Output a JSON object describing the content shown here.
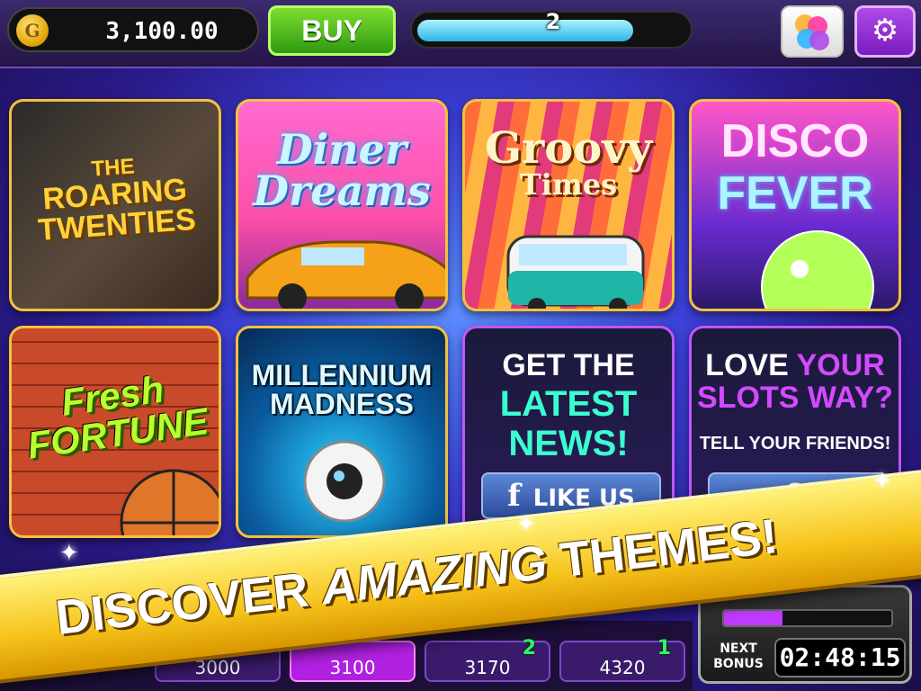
{
  "top_bar": {
    "balance": "3,100.00",
    "coin_symbol": "G",
    "buy_label": "BUY",
    "level": "2",
    "level_progress_pct": 80,
    "icons": {
      "game_center": "game-center-icon",
      "settings": "gear-icon"
    }
  },
  "themes": [
    {
      "title_lines": [
        "THE",
        "ROARING",
        "TWENTIES"
      ]
    },
    {
      "title_lines": [
        "Diner",
        "Dreams"
      ]
    },
    {
      "title_lines": [
        "Groovy",
        "Times"
      ]
    },
    {
      "title_lines": [
        "DISCO",
        "FEVER"
      ]
    },
    {
      "title_lines": [
        "Fresh",
        "FORTUNE"
      ]
    },
    {
      "title_lines": [
        "MILLENNIUM",
        "MADNESS"
      ]
    }
  ],
  "news_card": {
    "line1": "GET THE",
    "line2": "LATEST",
    "line3": "NEWS!",
    "button_label": "LIKE US",
    "fb_glyph": "f"
  },
  "share_card": {
    "line1_a": "LOVE",
    "line1_b": "YOUR",
    "line2": "SLOTS WAY?",
    "line3": "TELL YOUR FRIENDS!",
    "fb_glyph": "f"
  },
  "banner": {
    "word1": "DISCOVER",
    "word2": "AMAZING",
    "word3": "THEMES!"
  },
  "leaderboard": [
    {
      "score": "3000",
      "rank": ""
    },
    {
      "score": "3100",
      "rank": ""
    },
    {
      "score": "3170",
      "rank": "2"
    },
    {
      "score": "4320",
      "rank": "1"
    }
  ],
  "bonus": {
    "label_line1": "NEXT",
    "label_line2": "BONUS",
    "timer": "02:48:15",
    "meter_pct": 35
  },
  "colors": {
    "accent_gold": "#f3c23a",
    "buy_green": "#2f9a10",
    "settings_purple": "#9a2ad8",
    "news_mint": "#3affd0",
    "share_violet": "#d34aff"
  }
}
